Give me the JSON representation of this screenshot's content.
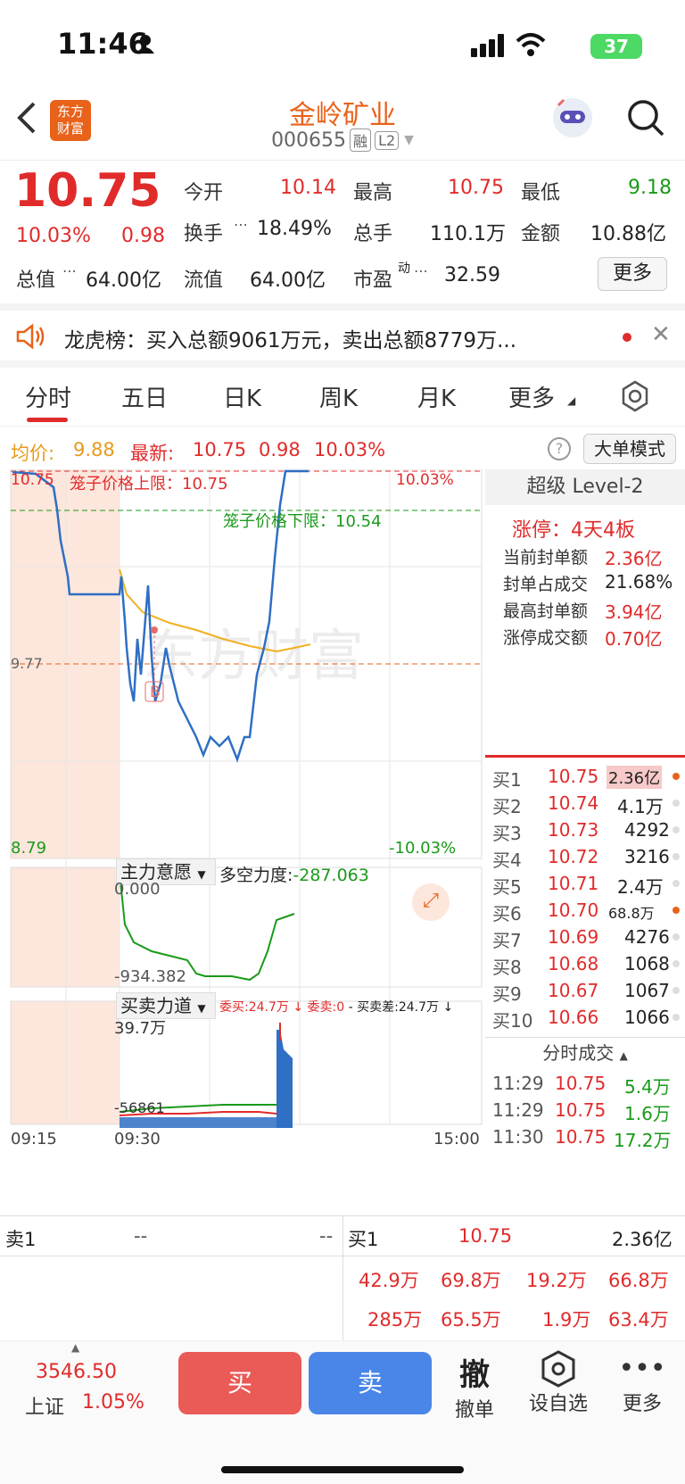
{
  "status_bar": {
    "time": "11:46",
    "battery": "37"
  },
  "header": {
    "logo_text_1": "东方",
    "logo_text_2": "财富",
    "stock_name": "金岭矿业",
    "stock_code": "000655",
    "tag_margin": "融",
    "tag_level": "L2"
  },
  "quote": {
    "price": "10.75",
    "change_pct": "10.03%",
    "change_amt": "0.98",
    "open_label": "今开",
    "open": "10.14",
    "high_label": "最高",
    "high": "10.75",
    "low_label": "最低",
    "low": "9.18",
    "turnover_label": "换手",
    "turnover": "18.49%",
    "volume_label": "总手",
    "volume": "110.1万",
    "amount_label": "金额",
    "amount": "10.88亿",
    "mktcap_label": "总值",
    "mktcap": "64.00亿",
    "float_label": "流值",
    "float_cap": "64.00亿",
    "pe_label": "市盈",
    "pe_sup": "动",
    "pe": "32.59",
    "more_button": "更多"
  },
  "dragon_tiger": {
    "text": "龙虎榜：买入总额9061万元，卖出总额8779万..."
  },
  "tabs": [
    {
      "label": "分时"
    },
    {
      "label": "五日"
    },
    {
      "label": "日K"
    },
    {
      "label": "周K"
    },
    {
      "label": "月K"
    },
    {
      "label": "更多"
    }
  ],
  "info_row": {
    "avg_label": "均价:",
    "avg": "9.88",
    "latest_label": "最新:",
    "latest": "10.75",
    "latest_chg": "0.98",
    "latest_pct": "10.03%",
    "big_order_mode": "大单模式"
  },
  "chart": {
    "y_top_left": "10.75",
    "y_top_right": "10.03%",
    "y_mid": "9.77",
    "y_bottom_left": "8.79",
    "y_bottom_right": "-10.03%",
    "cage_upper": "笼子价格上限：10.75",
    "cage_lower": "笼子价格下限：10.54",
    "b_marker": "B",
    "watermark": "东方财富",
    "colors": {
      "price_line": "#2f6fc4",
      "avg_line": "#f2b020",
      "up": "#e02b2b",
      "down": "#1a9a1a",
      "volume": "#2f6fc4"
    }
  },
  "indicator1": {
    "name": "主力意愿",
    "label": "多空力度:",
    "value": "-287.063",
    "y_top": "0.000",
    "y_low": "-934.382"
  },
  "indicator2": {
    "name": "买卖力道",
    "buy_label": "委买:24.7万",
    "sell_label": "委卖:0",
    "diff_label": "买卖差:24.7万",
    "y_top": "39.7万",
    "y_low": "-56861",
    "x_start": "09:15",
    "x_open": "09:30",
    "x_end": "15:00"
  },
  "right_panel": {
    "title": "超级 Level-2",
    "limit_up_label": "涨停：",
    "limit_up_value": "4天4板",
    "stats": [
      {
        "label": "当前封单额",
        "value": "2.36亿"
      },
      {
        "label": "封单占成交",
        "value": "21.68%"
      },
      {
        "label": "最高封单额",
        "value": "3.94亿"
      },
      {
        "label": "涨停成交额",
        "value": "0.70亿"
      }
    ],
    "bids": [
      {
        "label": "买1",
        "price": "10.75",
        "vol": "2.36亿"
      },
      {
        "label": "买2",
        "price": "10.74",
        "vol": "4.1万"
      },
      {
        "label": "买3",
        "price": "10.73",
        "vol": "4292"
      },
      {
        "label": "买4",
        "price": "10.72",
        "vol": "3216"
      },
      {
        "label": "买5",
        "price": "10.71",
        "vol": "2.4万"
      },
      {
        "label": "买6",
        "price": "10.70",
        "vol": "68.8万"
      },
      {
        "label": "买7",
        "price": "10.69",
        "vol": "4276"
      },
      {
        "label": "买8",
        "price": "10.68",
        "vol": "1068"
      },
      {
        "label": "买9",
        "price": "10.67",
        "vol": "1067"
      },
      {
        "label": "买10",
        "price": "10.66",
        "vol": "1066"
      }
    ],
    "ticks_title": "分时成交",
    "ticks": [
      {
        "time": "11:29",
        "price": "10.75",
        "vol": "5.4万"
      },
      {
        "time": "11:29",
        "price": "10.75",
        "vol": "1.6万"
      },
      {
        "time": "11:30",
        "price": "10.75",
        "vol": "17.2万"
      }
    ]
  },
  "order_row": {
    "sell1_label": "卖1",
    "sell1_price": "--",
    "sell1_vol": "--",
    "buy1_label": "买1",
    "buy1_price": "10.75",
    "buy1_vol": "2.36亿",
    "queue_row1": [
      "42.9万",
      "69.8万",
      "19.2万",
      "66.8万"
    ],
    "queue_row2": [
      "285万",
      "65.5万",
      "1.9万",
      "63.4万"
    ]
  },
  "bottom_bar": {
    "index_value": "3546.50",
    "index_name": "上证",
    "index_pct": "1.05%",
    "buy_button": "买",
    "sell_button": "卖",
    "cancel_icon": "撤",
    "cancel_label": "撤单",
    "watch_label": "设自选",
    "more_label": "更多"
  }
}
